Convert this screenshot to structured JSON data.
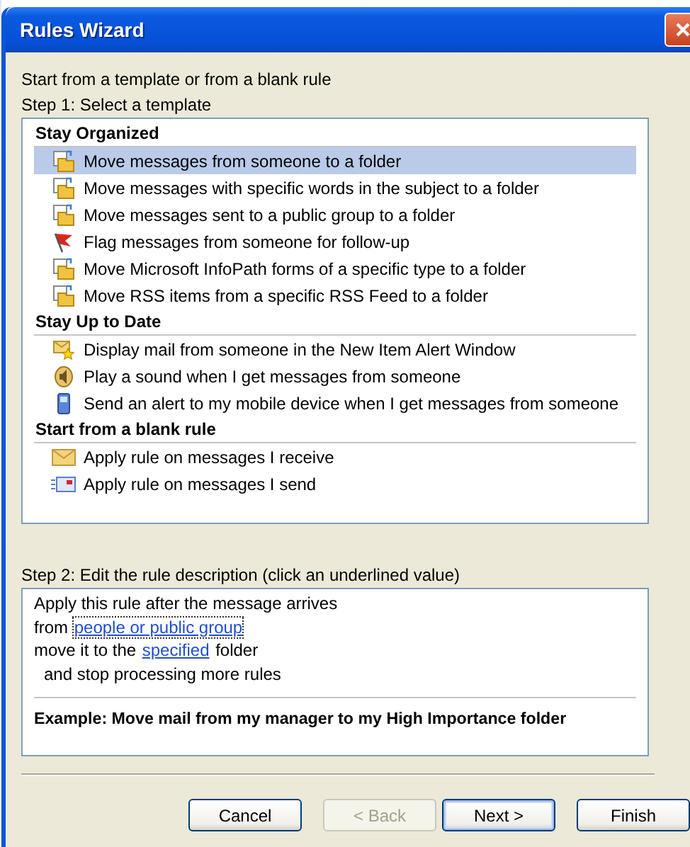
{
  "window": {
    "title": "Rules Wizard"
  },
  "intro": "Start from a template or from a blank rule",
  "step1_label": "Step 1: Select a template",
  "template_groups": [
    {
      "heading": "Stay Organized",
      "items": [
        {
          "label": "Move messages from someone to a folder",
          "kind": "folder",
          "selected": true
        },
        {
          "label": "Move messages with specific words in the subject to a folder",
          "kind": "folder",
          "selected": false
        },
        {
          "label": "Move messages sent to a public group to a folder",
          "kind": "folder",
          "selected": false
        },
        {
          "label": "Flag messages from someone for follow-up",
          "kind": "flag",
          "selected": false
        },
        {
          "label": "Move Microsoft InfoPath forms of a specific type to a folder",
          "kind": "folder",
          "selected": false
        },
        {
          "label": "Move RSS items from a specific RSS Feed to a folder",
          "kind": "folder",
          "selected": false
        }
      ]
    },
    {
      "heading": "Stay Up to Date",
      "items": [
        {
          "label": "Display mail from someone in the New Item Alert Window",
          "kind": "alert",
          "selected": false
        },
        {
          "label": "Play a sound when I get messages from someone",
          "kind": "sound",
          "selected": false
        },
        {
          "label": "Send an alert to my mobile device when I get messages from someone",
          "kind": "mobile",
          "selected": false
        }
      ]
    },
    {
      "heading": "Start from a blank rule",
      "items": [
        {
          "label": "Apply rule on messages I receive",
          "kind": "receive",
          "selected": false
        },
        {
          "label": "Apply rule on messages I send",
          "kind": "send",
          "selected": false
        }
      ]
    }
  ],
  "step2_label": "Step 2: Edit the rule description (click an underlined value)",
  "description": {
    "lines": [
      {
        "indented": false,
        "parts": [
          {
            "kind": "text",
            "text": "Apply this rule after the message arrives"
          }
        ]
      },
      {
        "indented": false,
        "parts": [
          {
            "kind": "text",
            "text": "from "
          },
          {
            "kind": "link",
            "text": "people or public group",
            "focused": true
          }
        ]
      },
      {
        "indented": false,
        "parts": [
          {
            "kind": "text",
            "text": "move it to the "
          },
          {
            "kind": "link",
            "text": "specified",
            "focused": false
          },
          {
            "kind": "text",
            "text": " folder"
          }
        ]
      },
      {
        "indented": true,
        "parts": [
          {
            "kind": "text",
            "text": "and stop processing more rules"
          }
        ]
      }
    ],
    "example": "Example: Move mail from my manager to my High Importance folder"
  },
  "buttons": [
    {
      "label": "Cancel",
      "disabled": false,
      "default": false
    },
    {
      "label": "< Back",
      "disabled": true,
      "default": false
    },
    {
      "label": "Next >",
      "disabled": false,
      "default": true
    },
    {
      "label": "Finish",
      "disabled": false,
      "default": false
    }
  ]
}
